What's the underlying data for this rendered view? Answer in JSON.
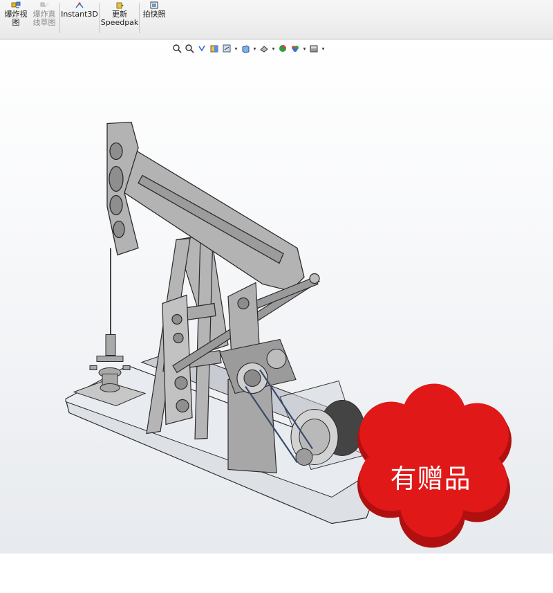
{
  "toolbar": {
    "buttons": [
      {
        "label_line1": "爆炸视",
        "label_line2": "图",
        "icon": "explode-view-icon",
        "enabled": true
      },
      {
        "label_line1": "爆炸直",
        "label_line2": "线草图",
        "icon": "explode-sketch-icon",
        "enabled": false
      },
      {
        "label_line1": "Instant3D",
        "label_line2": "",
        "icon": "instant3d-icon",
        "enabled": true
      },
      {
        "label_line1": "更新",
        "label_line2": "Speedpak",
        "icon": "update-speedpak-icon",
        "enabled": true
      },
      {
        "label_line1": "拍快照",
        "label_line2": "",
        "icon": "snapshot-icon",
        "enabled": true
      }
    ]
  },
  "heads_up": [
    "zoom-to-fit-icon",
    "zoom-area-icon",
    "previous-view-icon",
    "section-view-icon",
    "dynamic-annotation-icon",
    "view-orientation-icon",
    "display-style-icon",
    "hide-show-items-icon",
    "edit-appearance-icon",
    "apply-scene-icon",
    "view-settings-icon"
  ],
  "badge": {
    "text": "有赠品",
    "color": "#e01818"
  },
  "colors": {
    "model_fill": "#b8b8b8",
    "model_edge": "#2b2b2b",
    "base_fill": "#d8dce2"
  }
}
